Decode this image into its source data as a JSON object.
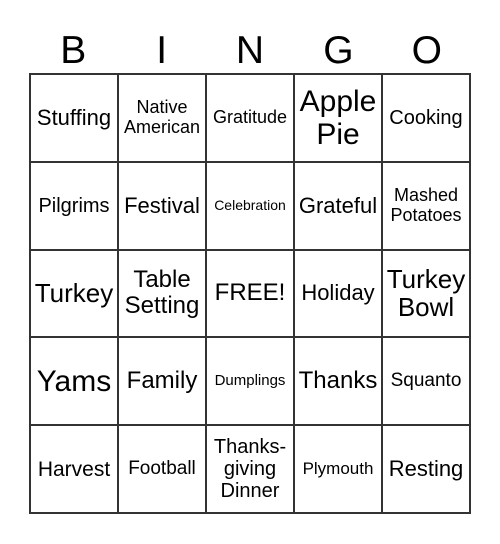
{
  "header": [
    "B",
    "I",
    "N",
    "G",
    "O"
  ],
  "cells": [
    [
      "Stuffing",
      "Native\nAmerican",
      "Gratitude",
      "Apple\nPie",
      "Cooking"
    ],
    [
      "Pilgrims",
      "Festival",
      "Celebration",
      "Grateful",
      "Mashed\nPotatoes"
    ],
    [
      "Turkey",
      "Table\nSetting",
      "FREE!",
      "Holiday",
      "Turkey\nBowl"
    ],
    [
      "Yams",
      "Family",
      "Dumplings",
      "Thanks",
      "Squanto"
    ],
    [
      "Harvest",
      "Football",
      "Thanks-\ngiving\nDinner",
      "Plymouth",
      "Resting"
    ]
  ]
}
